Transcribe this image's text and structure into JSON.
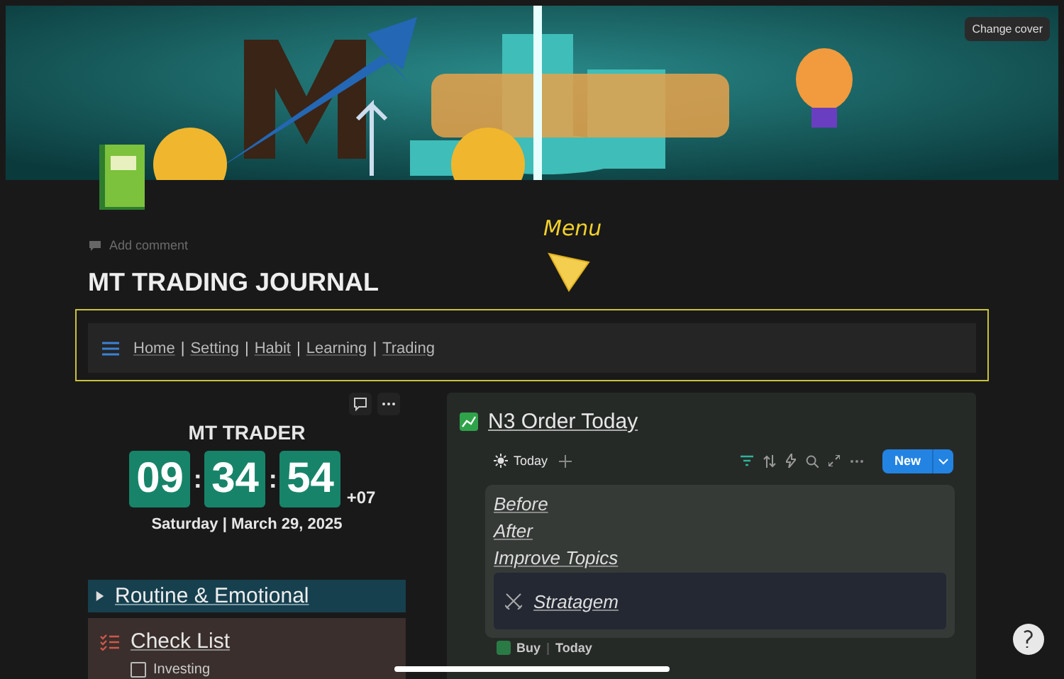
{
  "cover": {
    "button": "Change cover"
  },
  "page": {
    "add_comment": "Add comment",
    "title": "MT TRADING JOURNAL"
  },
  "annotation": {
    "label": "Menu"
  },
  "menu": {
    "links": [
      "Home",
      "Setting",
      "Habit",
      "Learning",
      "Trading"
    ],
    "separators": [
      "|",
      "|",
      "|",
      "|"
    ]
  },
  "clock_widget": {
    "title": "MT TRADER",
    "segments": [
      "09",
      "34",
      "54"
    ],
    "separators": [
      ":",
      ":"
    ],
    "offset": "+07",
    "date": "Saturday | March 29, 2025"
  },
  "toggles": [
    {
      "label": "Routine & Emotional",
      "expanded": false
    }
  ],
  "checklist": {
    "title": "Check List",
    "items": [
      {
        "label": "Investing",
        "checked": false
      }
    ]
  },
  "database": {
    "title": "N3 Order Today",
    "views": [
      {
        "label": "Today",
        "selected": true
      }
    ],
    "new_button": "New",
    "links": [
      "Before",
      "After",
      "Improve Topics"
    ],
    "callout": {
      "label": "Stratagem"
    },
    "next_row": {
      "title": "Buy",
      "separator": "|",
      "view": "Today"
    }
  }
}
